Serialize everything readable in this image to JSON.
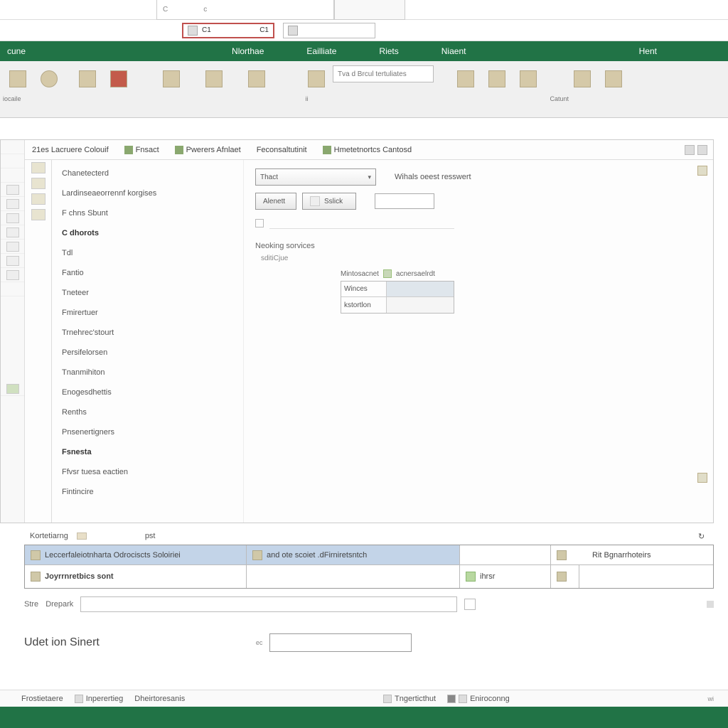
{
  "titlebar": {
    "tab1": "C",
    "tab2": "c"
  },
  "subtabs": {
    "tab1_a": "C1",
    "tab1_b": "C1",
    "tab2": ""
  },
  "ribbon": {
    "left_label": "cune",
    "tabs": [
      "Nlorthae",
      "Eailliate",
      "Riets",
      "Niaent"
    ],
    "right": "Hent"
  },
  "toolbar": {
    "left_label": "iocaile",
    "search_placeholder": "Tva d Brcul tertuliates",
    "group_label": "Catunt",
    "sub_line": "ii"
  },
  "panel": {
    "tabs": [
      "21es Lacruere Colouif",
      "Fnsact",
      "Pwerers Afnlaet",
      "Feconsaltutinit",
      "Hmetetnortcs Cantosd"
    ],
    "nav": {
      "top": [
        "Chanetecterd",
        "Lardinseaeorrennf  korgises",
        "F chns Sbunt"
      ],
      "section": "C dhorots",
      "items": [
        "Tdl",
        "Fantio",
        "Tneteer",
        "Fmirertuer",
        "Trnehrec'stourt",
        "Persifelorsen",
        "Tnanmihiton",
        "Enogesdhettis",
        "Renths",
        "Pnsenertigners"
      ],
      "bottom_section": "Fsnesta",
      "bottom": [
        "Ffvsr tuesa eactien",
        "Fintincire"
      ]
    },
    "form": {
      "dropdown1": "Thact",
      "right_label": "Wihals oeest resswert",
      "btn1": "Alenett",
      "btn2": "Sslick",
      "section": "Neoking  sorvices",
      "sub_label": "sditiCjue",
      "subform_label1": "Mintosacnet",
      "subform_label2": "acnersaelrdt",
      "mt_rows": [
        "Winces",
        "kstortlon"
      ]
    }
  },
  "bottom": {
    "header_left": "Kortetiarng",
    "header_right": "pst",
    "row1": {
      "c1": "Leccerfaleiotnharta   Odrociscts Soloiriei",
      "c2": "and ote scoiet .dFirniretsntch",
      "c3": "",
      "c4": "Rit Bgnarrhoteirs"
    },
    "row2": {
      "c1": "Joyrrnretbics  sont",
      "c2": "",
      "c3": "ihrsr",
      "c4": ""
    }
  },
  "search": {
    "label1": "Stre",
    "label2": "Drepark"
  },
  "location": {
    "label": "Udet ion Sinert",
    "small": "ec"
  },
  "status": {
    "left": [
      "Frostietaere",
      "Inperertieg",
      "Dheirtoresanis"
    ],
    "center": [
      "Tngerticthut",
      "Eniroconng"
    ],
    "right": "wi"
  }
}
